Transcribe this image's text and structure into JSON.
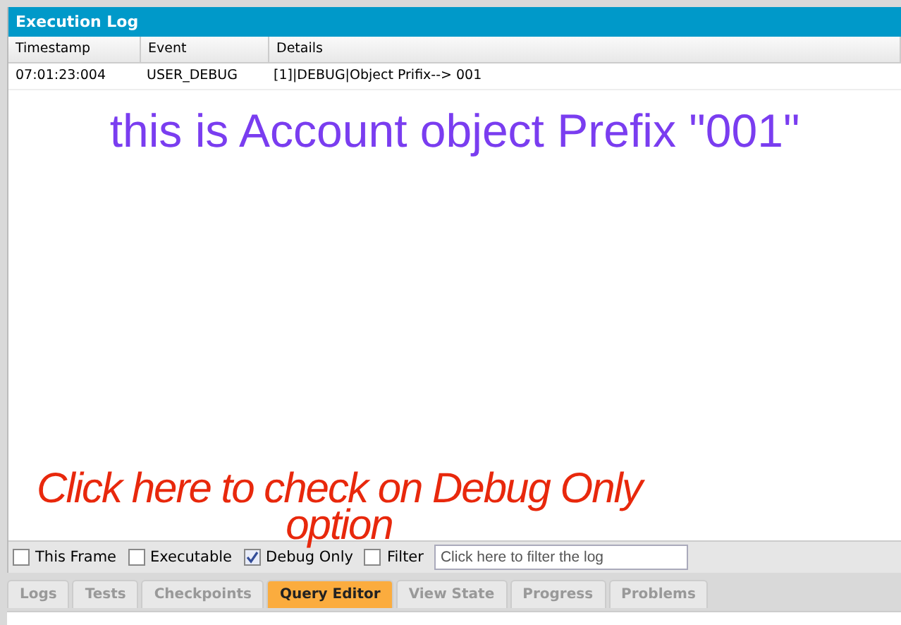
{
  "panel": {
    "title": "Execution Log"
  },
  "table": {
    "columns": [
      "Timestamp",
      "Event",
      "Details"
    ],
    "rows": [
      {
        "timestamp": "07:01:23:004",
        "event": "USER_DEBUG",
        "details": "[1]|DEBUG|Object Prifix--> 001"
      }
    ]
  },
  "annotations": [
    {
      "kind": "note",
      "text": "this is Account object Prefix \"001\""
    },
    {
      "kind": "callout",
      "text": "Click here to check on Debug Only option"
    }
  ],
  "filters": [
    {
      "label": "This Frame",
      "checked": false
    },
    {
      "label": "Executable",
      "checked": false
    },
    {
      "label": "Debug Only",
      "checked": true
    },
    {
      "label": "Filter",
      "checked": false
    }
  ],
  "filter_field": {
    "placeholder": "Click here to filter the log"
  },
  "tabs": [
    {
      "label": "Logs",
      "selected": false
    },
    {
      "label": "Tests",
      "selected": false
    },
    {
      "label": "Checkpoints",
      "selected": false
    },
    {
      "label": "Query Editor",
      "selected": true
    },
    {
      "label": "View State",
      "selected": false
    },
    {
      "label": "Progress",
      "selected": false
    },
    {
      "label": "Problems",
      "selected": false
    }
  ]
}
